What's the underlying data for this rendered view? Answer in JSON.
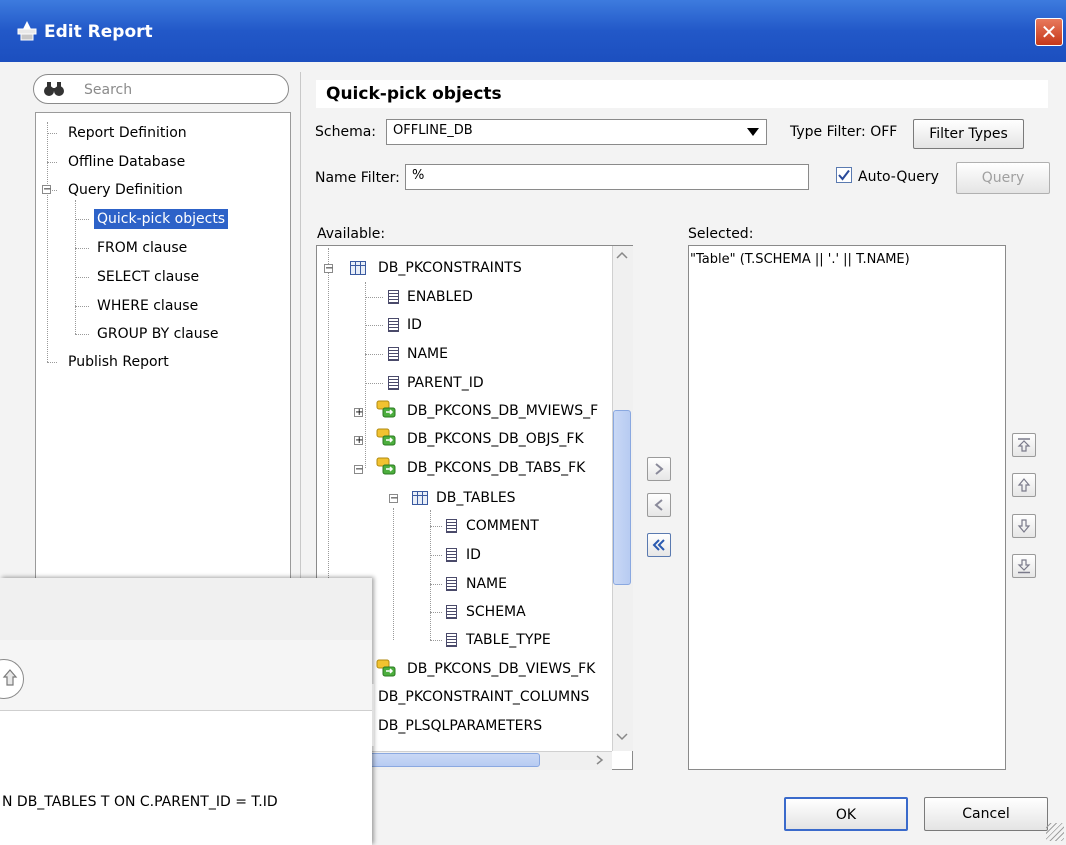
{
  "window": {
    "title": "Edit Report",
    "close_glyph": "✕"
  },
  "search": {
    "placeholder": "Search"
  },
  "nav": {
    "items": [
      {
        "label": "Report Definition"
      },
      {
        "label": "Offline Database"
      },
      {
        "label": "Query Definition"
      },
      {
        "label": "Quick-pick objects"
      },
      {
        "label": "FROM clause"
      },
      {
        "label": "SELECT clause"
      },
      {
        "label": "WHERE clause"
      },
      {
        "label": "GROUP BY clause"
      },
      {
        "label": "Publish Report"
      }
    ]
  },
  "main": {
    "section_title": "Quick-pick objects",
    "schema_label": "Schema:",
    "schema_value": "OFFLINE_DB",
    "type_filter_label": "Type Filter: OFF",
    "filter_types_button": "Filter Types",
    "name_filter_label": "Name Filter:",
    "name_filter_value": "%",
    "auto_query_label": "Auto-Query",
    "auto_query_checked": true,
    "query_button": "Query",
    "available_label": "Available:",
    "selected_label": "Selected:",
    "available_tree": [
      {
        "label": "DB_PKCONSTRAINTS"
      },
      {
        "label": "ENABLED"
      },
      {
        "label": "ID"
      },
      {
        "label": "NAME"
      },
      {
        "label": "PARENT_ID"
      },
      {
        "label": "DB_PKCONS_DB_MVIEWS_F"
      },
      {
        "label": "DB_PKCONS_DB_OBJS_FK"
      },
      {
        "label": "DB_PKCONS_DB_TABS_FK"
      },
      {
        "label": "DB_TABLES"
      },
      {
        "label": "COMMENT"
      },
      {
        "label": "ID"
      },
      {
        "label": "NAME"
      },
      {
        "label": "SCHEMA"
      },
      {
        "label": "TABLE_TYPE"
      },
      {
        "label": "DB_PKCONS_DB_VIEWS_FK"
      },
      {
        "label": "DB_PKCONSTRAINT_COLUMNS"
      },
      {
        "label": "DB_PLSQLPARAMETERS"
      }
    ],
    "selected_items": [
      "\"Table\" (T.SCHEMA || '.' || T.NAME)"
    ]
  },
  "footer": {
    "ok": "OK",
    "cancel": "Cancel"
  },
  "overlay": {
    "sql_fragment": "N DB_TABLES T ON C.PARENT_ID = T.ID"
  }
}
